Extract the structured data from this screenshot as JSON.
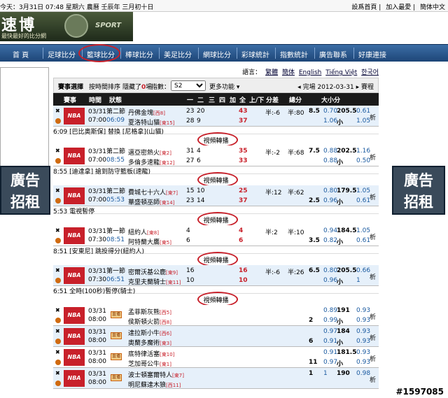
{
  "topbar": {
    "date_text": "今天：3月31日 07:48 星期六 農曆 壬辰年 三月初十日",
    "links": [
      "設爲首頁",
      "加入最愛",
      "簡体中文"
    ]
  },
  "logo": {
    "title": "速博",
    "subtitle": "最快最好的比分網",
    "sport": "SPORT"
  },
  "nav": {
    "items": [
      "首 頁",
      "足球比分",
      "籃球比分",
      "棒球比分",
      "美足比分",
      "網球比分",
      "彩球統計",
      "指數統計",
      "廣告聯系",
      "好康連接"
    ]
  },
  "ads": {
    "left": [
      "廣告",
      "招租"
    ],
    "right": [
      "廣告",
      "招租"
    ]
  },
  "lang": {
    "label": "語言：",
    "options": [
      "繁體",
      "簡体",
      "English",
      "Tiếng Việt",
      "한국어"
    ]
  },
  "controls": {
    "select_matches": "賽事選擇",
    "sort_by_time": "按時間排序",
    "hidden_prefix": "隱藏了",
    "hidden_count": "0",
    "hidden_suffix": "場",
    "index_label": "指數：",
    "index_value": "S2",
    "more": "更多功能",
    "finished": "完場 2012-03-31",
    "schedule": "賽程"
  },
  "headers": [
    "賽事",
    "時間",
    "狀態",
    "",
    "一",
    "二",
    "三",
    "四",
    "加",
    "全",
    "上/下",
    "分差",
    "總分",
    "大小分"
  ],
  "games": [
    {
      "league": "NBA",
      "date": "03/31",
      "time": "07:00",
      "status1": "第二節",
      "status2": "06:09",
      "home": "丹佛金塊",
      "home_rank": "[西8]",
      "away": "夏洛特山貓",
      "away_rank": "[東15]",
      "hq": [
        "23",
        "20"
      ],
      "aq": [
        "28",
        "9"
      ],
      "htot": "43",
      "atot": "37",
      "half": "半:-6",
      "diff": "半:80",
      "o1": [
        "8.5",
        "0.70",
        "205.5",
        "0.61"
      ],
      "o2": [
        "",
        "1.06",
        "小",
        "1.05"
      ],
      "side": "析",
      "bg": "blue"
    },
    {
      "league": "NBA",
      "date": "03/31",
      "time": "07:00",
      "status1": "第二節",
      "status2": "08:55",
      "home": "邁亞密熱火",
      "home_rank": "[東2]",
      "away": "多倫多速龍",
      "away_rank": "[東12]",
      "hq": [
        "31",
        "4"
      ],
      "aq": [
        "27",
        "6"
      ],
      "htot": "35",
      "atot": "33",
      "half": "半:-2",
      "diff": "半:68",
      "o1": [
        "7.5",
        "0.88",
        "202.5",
        "1.16"
      ],
      "o2": [
        "",
        "0.88",
        "小",
        "0.50"
      ],
      "side": "析",
      "bg": "white"
    },
    {
      "league": "NBA",
      "date": "03/31",
      "time": "07:00",
      "status1": "第二節",
      "status2": "05:53",
      "home": "費城七十六人",
      "home_rank": "[東7]",
      "away": "華盛頓巫師",
      "away_rank": "[東14]",
      "hq": [
        "15",
        "10"
      ],
      "aq": [
        "23",
        "14"
      ],
      "htot": "25",
      "atot": "37",
      "half": "半:12",
      "diff": "半:62",
      "o1": [
        "",
        "0.80",
        "179.5",
        "1.05"
      ],
      "o2": [
        "2.5",
        "0.96",
        "小",
        "0.61"
      ],
      "side": "析",
      "bg": "blue"
    },
    {
      "league": "NBA",
      "date": "03/31",
      "time": "07:30",
      "status1": "第一節",
      "status2": "08:51",
      "home": "紐約人",
      "home_rank": "[東8]",
      "away": "阿特蘭大鷹",
      "away_rank": "[東5]",
      "hq": [
        "4",
        ""
      ],
      "aq": [
        "6",
        ""
      ],
      "htot": "4",
      "atot": "6",
      "half": "半:2",
      "diff": "半:10",
      "o1": [
        "",
        "0.94",
        "184.5",
        "1.05"
      ],
      "o2": [
        "3.5",
        "0.82",
        "小",
        "0.61"
      ],
      "side": "析",
      "bg": "white"
    },
    {
      "league": "NBA",
      "date": "03/31",
      "time": "07:30",
      "status1": "第一節",
      "status2": "06:51",
      "home": "密爾沃基公鹿",
      "home_rank": "[東9]",
      "away": "克里夫蘭騎士",
      "away_rank": "[東11]",
      "hq": [
        "16",
        ""
      ],
      "aq": [
        "10",
        ""
      ],
      "htot": "16",
      "atot": "10",
      "half": "半:-6",
      "diff": "半:26",
      "o1": [
        "6.5",
        "0.80",
        "205.5",
        "0.66"
      ],
      "o2": [
        "",
        "0.96",
        "小",
        "1"
      ],
      "side": "析",
      "bg": "blue"
    },
    {
      "league": "NBA",
      "date": "03/31",
      "time": "08:00",
      "status1": "",
      "status2": "",
      "home": "孟菲斯灰熊",
      "home_rank": "[西5]",
      "away": "侯斯頓火箭",
      "away_rank": "[西8]",
      "hq": [
        "",
        ""
      ],
      "aq": [
        "",
        ""
      ],
      "htot": "",
      "atot": "",
      "half": "",
      "diff": "",
      "o1": [
        "",
        "0.89",
        "191",
        "0.93"
      ],
      "o2": [
        "2",
        "0.99",
        "小",
        "0.93"
      ],
      "side": "析",
      "bg": "white"
    },
    {
      "league": "NBA",
      "date": "03/31",
      "time": "08:00",
      "status1": "",
      "status2": "",
      "home": "達拉斯小牛",
      "home_rank": "[西6]",
      "away": "奧蘭多魔術",
      "away_rank": "[東3]",
      "hq": [
        "",
        ""
      ],
      "aq": [
        "",
        ""
      ],
      "htot": "",
      "atot": "",
      "half": "",
      "diff": "",
      "o1": [
        "",
        "0.97",
        "184",
        "0.93"
      ],
      "o2": [
        "6",
        "0.91",
        "小",
        "0.93"
      ],
      "side": "析",
      "bg": "blue"
    },
    {
      "league": "NBA",
      "date": "03/31",
      "time": "08:00",
      "status1": "",
      "status2": "",
      "home": "底特律活塞",
      "home_rank": "[東10]",
      "away": "芝加哥公牛",
      "away_rank": "[東1]",
      "hq": [
        "",
        ""
      ],
      "aq": [
        "",
        ""
      ],
      "htot": "",
      "atot": "",
      "half": "",
      "diff": "",
      "o1": [
        "",
        "0.91",
        "181.5",
        "0.93"
      ],
      "o2": [
        "11",
        "0.97",
        "小",
        "0.93"
      ],
      "side": "析",
      "bg": "white"
    },
    {
      "league": "NBA",
      "date": "03/31",
      "time": "08:00",
      "status1": "",
      "status2": "",
      "home": "波士頓塞爾特人",
      "home_rank": "[東7]",
      "away": "明尼蘇達木狼",
      "away_rank": "[西11]",
      "hq": [
        "",
        ""
      ],
      "aq": [
        "",
        ""
      ],
      "htot": "",
      "atot": "",
      "half": "",
      "diff": "",
      "o1": [
        "1",
        "1",
        "190",
        "0.98"
      ],
      "o2": [
        "",
        "",
        "",
        ""
      ],
      "side": "析",
      "bg": "blue"
    }
  ],
  "notes": [
    "6:09 [巴比奧斯保] 替換 [尼格拿](山貓)",
    "8:55 [迪達拿] 搶到防守籃板(速龍)",
    "5:53 電視暫停",
    "8:51 [安東尼] 跳投得分(紐約人)",
    "6:51 全時(100秒)暫停(騎士)"
  ],
  "video_label": "視頻轉播",
  "signal_label": "直播",
  "watermark": "#1597085"
}
